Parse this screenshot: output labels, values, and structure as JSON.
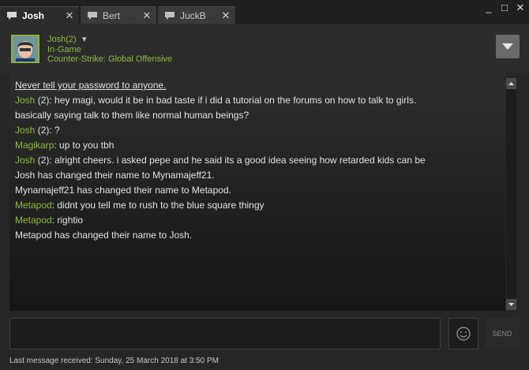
{
  "tabs": [
    {
      "label": "Josh",
      "icon": "chat-bubble-icon",
      "active": true
    },
    {
      "label": "Bert",
      "icon": "chat-bubble-icon",
      "active": false
    },
    {
      "label": "JuckB",
      "icon": "chat-bubble-icon",
      "active": false
    }
  ],
  "window_controls": {
    "minimize": "_",
    "maximize": "□",
    "close": "✕"
  },
  "header": {
    "name": "Josh(2)",
    "status": "In-Game",
    "game": "Counter-Strike: Global Offensive"
  },
  "colors": {
    "accent": "#8fb93f",
    "background": "#262626"
  },
  "messages": [
    {
      "sender": "",
      "text": "Never tell your password to anyone.",
      "type": "warning"
    },
    {
      "sender": "Josh",
      "text": " (2): hey magi, would it be in bad taste if i did a tutorial on the forums on how to talk to girls."
    },
    {
      "sender": "",
      "text": "basically saying talk to them like normal human beings?"
    },
    {
      "sender": "Josh",
      "text": " (2): ?"
    },
    {
      "sender": "Magikarp",
      "text": ": up to you tbh"
    },
    {
      "sender": "Josh",
      "text": " (2): alright cheers. i asked pepe and he said its a good idea seeing how retarded kids can be"
    },
    {
      "sender": "",
      "text": "Josh has changed their name to Mynamajeff21."
    },
    {
      "sender": "",
      "text": "Mynamajeff21 has changed their name to Metapod."
    },
    {
      "sender": "Metapod",
      "text": ": didnt you tell me to rush to the blue square thingy"
    },
    {
      "sender": "Metapod",
      "text": ": rightio"
    },
    {
      "sender": "",
      "text": "Metapod has changed their name to Josh."
    }
  ],
  "input": {
    "value": "",
    "placeholder": ""
  },
  "send_label": "SEND",
  "footer": "Last message received: Sunday, 25 March 2018 at 3:50 PM"
}
